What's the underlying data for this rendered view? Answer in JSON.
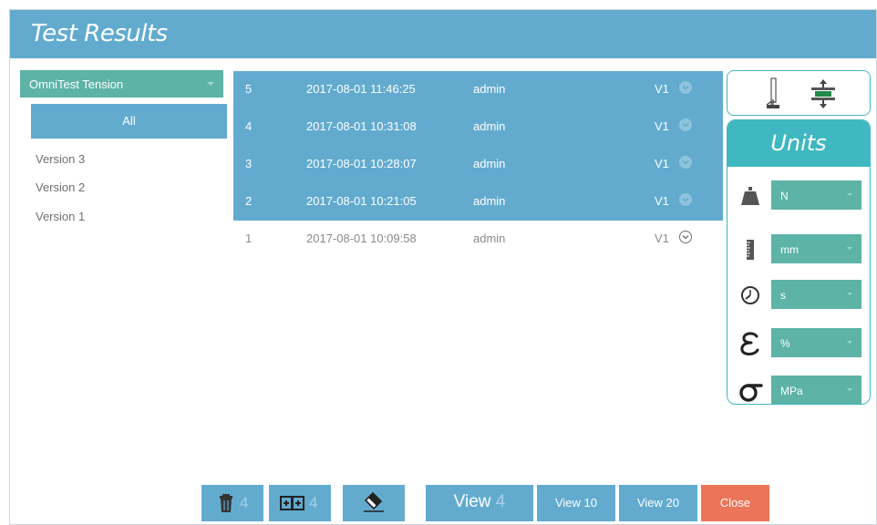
{
  "window": {
    "title": "Test Results"
  },
  "left_panel": {
    "machine_select": "OmniTest Tension",
    "versions": [
      {
        "label": "All",
        "selected": true
      },
      {
        "label": "Version 3"
      },
      {
        "label": "Version 2"
      },
      {
        "label": "Version 1"
      }
    ]
  },
  "results": [
    {
      "num": "5",
      "datetime": "2017-08-01 11:46:25",
      "user": "admin",
      "version": "V1",
      "selected": true
    },
    {
      "num": "4",
      "datetime": "2017-08-01 10:31:08",
      "user": "admin",
      "version": "V1",
      "selected": true
    },
    {
      "num": "3",
      "datetime": "2017-08-01 10:28:07",
      "user": "admin",
      "version": "V1",
      "selected": true
    },
    {
      "num": "2",
      "datetime": "2017-08-01 10:21:05",
      "user": "admin",
      "version": "V1",
      "selected": true
    },
    {
      "num": "1",
      "datetime": "2017-08-01 10:09:58",
      "user": "admin",
      "version": "V1",
      "selected": false
    }
  ],
  "mode_icons": [
    "test-stand-icon",
    "compression-fixture-icon"
  ],
  "units": {
    "header": "Units",
    "rows": [
      {
        "icon": "weight-icon",
        "value": "N"
      },
      {
        "icon": "ruler-icon",
        "value": "mm"
      },
      {
        "icon": "stopwatch-icon",
        "value": "s"
      },
      {
        "icon": "epsilon-strain-icon",
        "value": "%"
      },
      {
        "icon": "sigma-stress-icon",
        "value": "MPa"
      }
    ]
  },
  "toolbar": {
    "delete_count": "4",
    "export_count": "4",
    "view_label": "View",
    "view_count": "4",
    "view10_label": "View 10",
    "view20_label": "View 20",
    "close_label": "Close"
  },
  "colors": {
    "header_blue": "#62abcf",
    "teal": "#5cb3a6",
    "units_cyan": "#3fb8c2",
    "close_orange": "#ec7458"
  }
}
